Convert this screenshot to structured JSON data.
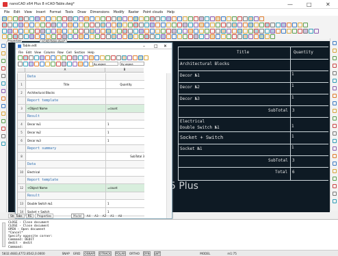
{
  "window": {
    "title": "nanoCAD x64 Plus 8 nCAD-Table.dwg*",
    "controls": [
      "—",
      "□",
      "✕"
    ]
  },
  "menu": [
    "File",
    "Edit",
    "View",
    "Insert",
    "Format",
    "Tools",
    "Draw",
    "Dimensions",
    "Modify",
    "Raster",
    "Point clouds",
    "Help"
  ],
  "panels": {
    "properties_label": "Properties",
    "doc_tab": "nCAD-Table.dwg*"
  },
  "editor": {
    "title": "Table.edt",
    "menu": [
      "File",
      "Edit",
      "View",
      "Column",
      "Row",
      "Cell",
      "Section",
      "Help"
    ],
    "by_object_1": "By object",
    "by_object_2": "By object",
    "col_header_a": "A",
    "col_header_b": "B",
    "rows": [
      {
        "num": "",
        "c1": "Data",
        "c2": "",
        "type": "sec"
      },
      {
        "num": "1",
        "c1": "Title",
        "c2": "Quantity",
        "type": "hdr"
      },
      {
        "num": "2",
        "c1": "Architectural Blocks",
        "c2": "",
        "type": "norm"
      },
      {
        "num": "",
        "c1": "Report template",
        "c2": "",
        "type": "sec"
      },
      {
        "num": "3",
        "c1": "<Object Name",
        "c2": "=count",
        "type": "tmpl"
      },
      {
        "num": "",
        "c1": "Result",
        "c2": "",
        "type": "sec"
      },
      {
        "num": "4",
        "c1": "Decor №1",
        "c2": "1",
        "type": "norm"
      },
      {
        "num": "5",
        "c1": "Decor №2",
        "c2": "1",
        "type": "norm"
      },
      {
        "num": "6",
        "c1": "Decor №3",
        "c2": "1",
        "type": "norm"
      },
      {
        "num": "",
        "c1": "Report summary",
        "c2": "",
        "type": "sec"
      },
      {
        "num": "8",
        "c1": "",
        "c2": "SubTotal 3",
        "type": "norm"
      },
      {
        "num": "",
        "c1": "Data",
        "c2": "",
        "type": "sec"
      },
      {
        "num": "10",
        "c1": "Electrical",
        "c2": "",
        "type": "norm"
      },
      {
        "num": "",
        "c1": "Report template",
        "c2": "",
        "type": "sec"
      },
      {
        "num": "12",
        "c1": "<Object Name",
        "c2": "=count",
        "type": "tmpl"
      },
      {
        "num": "",
        "c1": "Result",
        "c2": "",
        "type": "sec"
      },
      {
        "num": "13",
        "c1": "Double Switch №1",
        "c2": "1",
        "type": "norm"
      },
      {
        "num": "14",
        "c1": "Socket + Switch",
        "c2": "1",
        "type": "norm"
      }
    ]
  },
  "drawing_table": {
    "header_title": "Title",
    "header_qty": "Quantity",
    "rows": [
      {
        "label": "Architectural Blocks",
        "qty": ""
      },
      {
        "label": "Decor №1",
        "qty": "1"
      },
      {
        "label": "Decor №2",
        "qty": "1"
      },
      {
        "label": "Decor №3",
        "qty": "1"
      },
      {
        "label": "SubTotal",
        "qty": "3"
      },
      {
        "label": "Electrical",
        "qty": ""
      },
      {
        "label": "Double Switch №1",
        "qty": "1"
      },
      {
        "label": "Socket + Switch",
        "qty": "1"
      },
      {
        "label": "Socket №1",
        "qty": "1"
      },
      {
        "label": "SubTotal",
        "qty": "3"
      },
      {
        "label": "Total",
        "qty": "6"
      }
    ],
    "watermark": "5 Plus"
  },
  "tabs": {
    "left": [
      "Str. Tabs",
      "RS",
      "Properties"
    ],
    "model": [
      "Model",
      "A4",
      "A3",
      "A2",
      "A1",
      "A0"
    ]
  },
  "console": {
    "lines": [
      "CLOSE - Close document",
      "CLOSE - Close document",
      "OPEN - Open document",
      "*Cancel*",
      "Specify opposite corner:",
      "Command: DEDIT",
      "dedit - dedit",
      "Command:"
    ]
  },
  "status": {
    "coords": "5832.4683,4772.8542,0.0000",
    "toggles": [
      "SNAP",
      "GRID",
      "OSNAP",
      "OTRACK",
      "POLAR",
      "ORTHO",
      "DYN",
      "LWT"
    ],
    "model": "MODEL",
    "scale": "m1:75"
  },
  "colors": {
    "drawing_bg": "#0e1a24",
    "section_text": "#2a6db0",
    "template_row": "#d8eedd"
  }
}
